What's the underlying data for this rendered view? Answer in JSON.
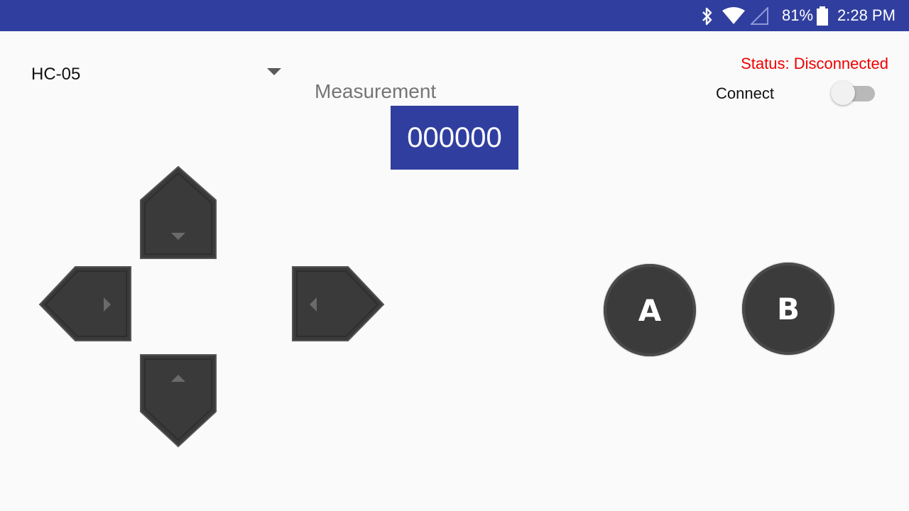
{
  "status_bar": {
    "battery": "81%",
    "time": "2:28 PM",
    "icons": [
      "bluetooth-icon",
      "wifi-icon",
      "cell-signal-icon",
      "battery-icon"
    ]
  },
  "device_selector": {
    "selected": "HC-05"
  },
  "connection": {
    "status": "Status: Disconnected",
    "connect_label": "Connect",
    "connected": false
  },
  "measurement": {
    "label": "Measurement",
    "value": "000000"
  },
  "buttons": {
    "a": "A",
    "b": "B"
  },
  "dpad": [
    "up-button",
    "left-button",
    "right-button",
    "down-button"
  ],
  "colors": {
    "primary": "#303f9f",
    "status_error": "#f00000",
    "button": "#3b3b3b",
    "background": "#fafafa"
  }
}
